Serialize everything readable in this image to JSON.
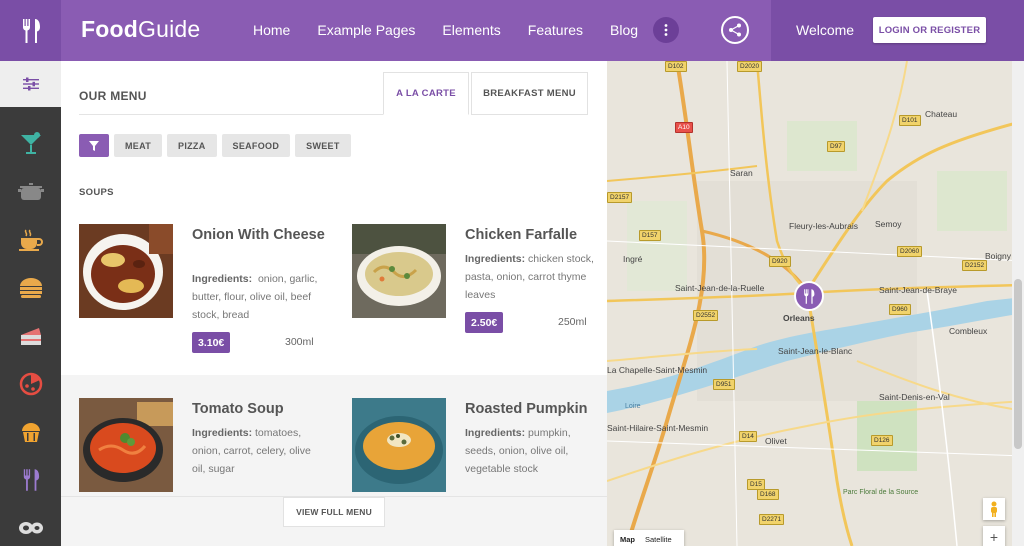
{
  "header": {
    "logo_bold": "Food",
    "logo_light": "Guide",
    "nav": [
      "Home",
      "Example Pages",
      "Elements",
      "Features",
      "Blog"
    ],
    "welcome": "Welcome",
    "login_label": "LOGIN OR REGISTER"
  },
  "menu": {
    "title": "OUR MENU",
    "tabs": [
      {
        "label": "A LA CARTE",
        "active": true
      },
      {
        "label": "BREAKFAST MENU",
        "active": false
      }
    ],
    "filters": [
      "MEAT",
      "PIZZA",
      "SEAFOOD",
      "SWEET"
    ],
    "section": "SOUPS",
    "ingredients_label": "Ingredients:",
    "items": [
      {
        "name": "Onion With Cheese",
        "ingredients": "onion, garlic, butter, flour, olive oil, beef stock, bread",
        "price": "3.10€",
        "volume": "300ml"
      },
      {
        "name": "Chicken Farfalle",
        "ingredients": "chicken stock, pasta, onion, carrot thyme leaves",
        "price": "2.50€",
        "volume": "250ml"
      },
      {
        "name": "Tomato Soup",
        "ingredients": "tomatoes, onion, carrot, celery, olive oil, sugar",
        "price": "",
        "volume": ""
      },
      {
        "name": "Roasted Pumpkin",
        "ingredients": "pumpkin, seeds, onion, olive oil, vegetable stock",
        "price": "",
        "volume": ""
      }
    ],
    "view_full": "VIEW FULL MENU"
  },
  "map": {
    "places": [
      "Chateau",
      "Saran",
      "Fleury-les-Aubrais",
      "Semoy",
      "Ingré",
      "Boigny",
      "Saint-Jean-de-la-Ruelle",
      "Saint-Jean-de-Braye",
      "Orleans",
      "Combleux",
      "Saint-Jean-le-Blanc",
      "La Chapelle-Saint-Mesmin",
      "Saint-Hilaire-Saint-Mesmin",
      "Saint-Denis-en-Val",
      "Olivet",
      "Parc Floral de la Source",
      "Loire"
    ],
    "roads": [
      "D102",
      "D2020",
      "D97",
      "D101",
      "A10",
      "D2157",
      "D2060",
      "D2152",
      "D157",
      "D920",
      "D960",
      "D2552",
      "D951",
      "D14",
      "D126",
      "D15",
      "D168",
      "D2271"
    ],
    "controls": {
      "map": "Map",
      "satellite": "Satellite"
    }
  }
}
